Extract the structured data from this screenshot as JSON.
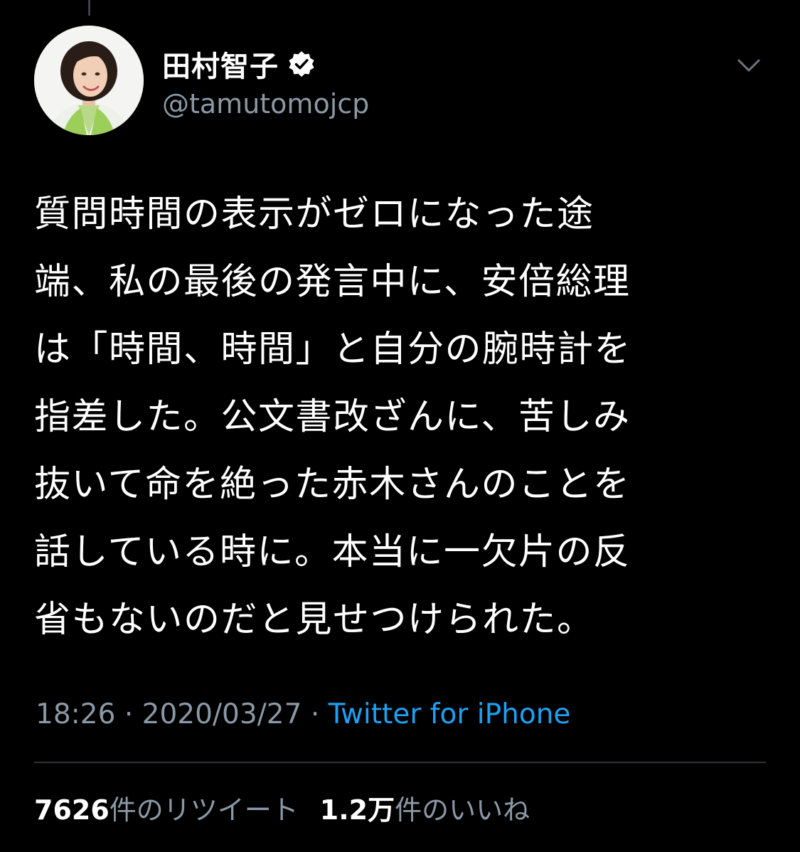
{
  "tweet": {
    "author": {
      "display_name": "田村智子",
      "handle": "@tamutomojcp",
      "verified": true,
      "avatar_icon": "profile-photo"
    },
    "text_lines": [
      "質問時間の表示がゼロになった途",
      "端、私の最後の発言中に、安倍総理",
      "は「時間、時間」と自分の腕時計を",
      "指差した。公文書改ざんに、苦しみ",
      "抜いて命を絶った赤木さんのことを",
      "話している時に。本当に一欠片の反",
      "省もないのだと見せつけられた。"
    ],
    "time": "18:26",
    "separator": "·",
    "date": "2020/03/27",
    "source": "Twitter for iPhone",
    "stats": {
      "retweets": {
        "count": "7626",
        "label": "件のリツイート"
      },
      "likes": {
        "count": "1.2万",
        "label": "件のいいね"
      }
    }
  },
  "icons": {
    "verified": "verified-badge-icon",
    "menu": "chevron-down-icon"
  },
  "colors": {
    "background": "#000000",
    "text": "#ffffff",
    "secondary_text": "#8b98a5",
    "link": "#1da1f2",
    "divider": "#2f3336"
  }
}
